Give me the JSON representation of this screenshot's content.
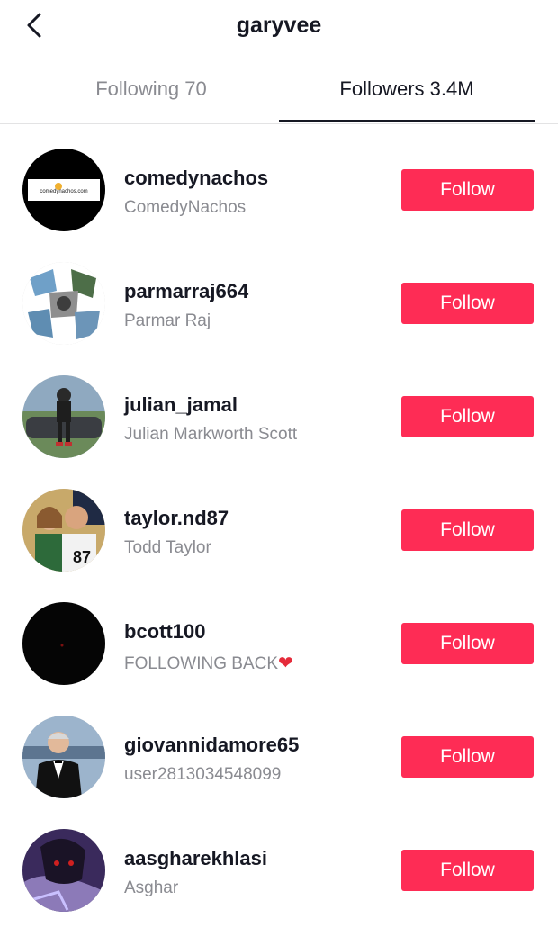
{
  "header": {
    "title": "garyvee",
    "back_icon": "chevron-left-icon"
  },
  "tabs": [
    {
      "label": "Following 70",
      "active": false
    },
    {
      "label": "Followers 3.4M",
      "active": true
    }
  ],
  "colors": {
    "accent": "#fe2c55",
    "text_primary": "#161823",
    "text_secondary": "#8a8b91"
  },
  "followers": [
    {
      "username": "comedynachos",
      "nickname": "ComedyNachos",
      "button": "Follow",
      "logo_text": "comedynachos.com"
    },
    {
      "username": "parmarraj664",
      "nickname": "Parmar Raj",
      "button": "Follow"
    },
    {
      "username": "julian_jamal",
      "nickname": "Julian Markworth Scott",
      "button": "Follow"
    },
    {
      "username": "taylor.nd87",
      "nickname": "Todd Taylor",
      "button": "Follow"
    },
    {
      "username": "bcott100",
      "nickname": "FOLLOWING BACK",
      "nickname_emoji": "❤",
      "button": "Follow"
    },
    {
      "username": "giovannidamore65",
      "nickname": "user2813034548099",
      "button": "Follow"
    },
    {
      "username": "aasgharekhlasi",
      "nickname": "Asghar",
      "button": "Follow"
    }
  ]
}
